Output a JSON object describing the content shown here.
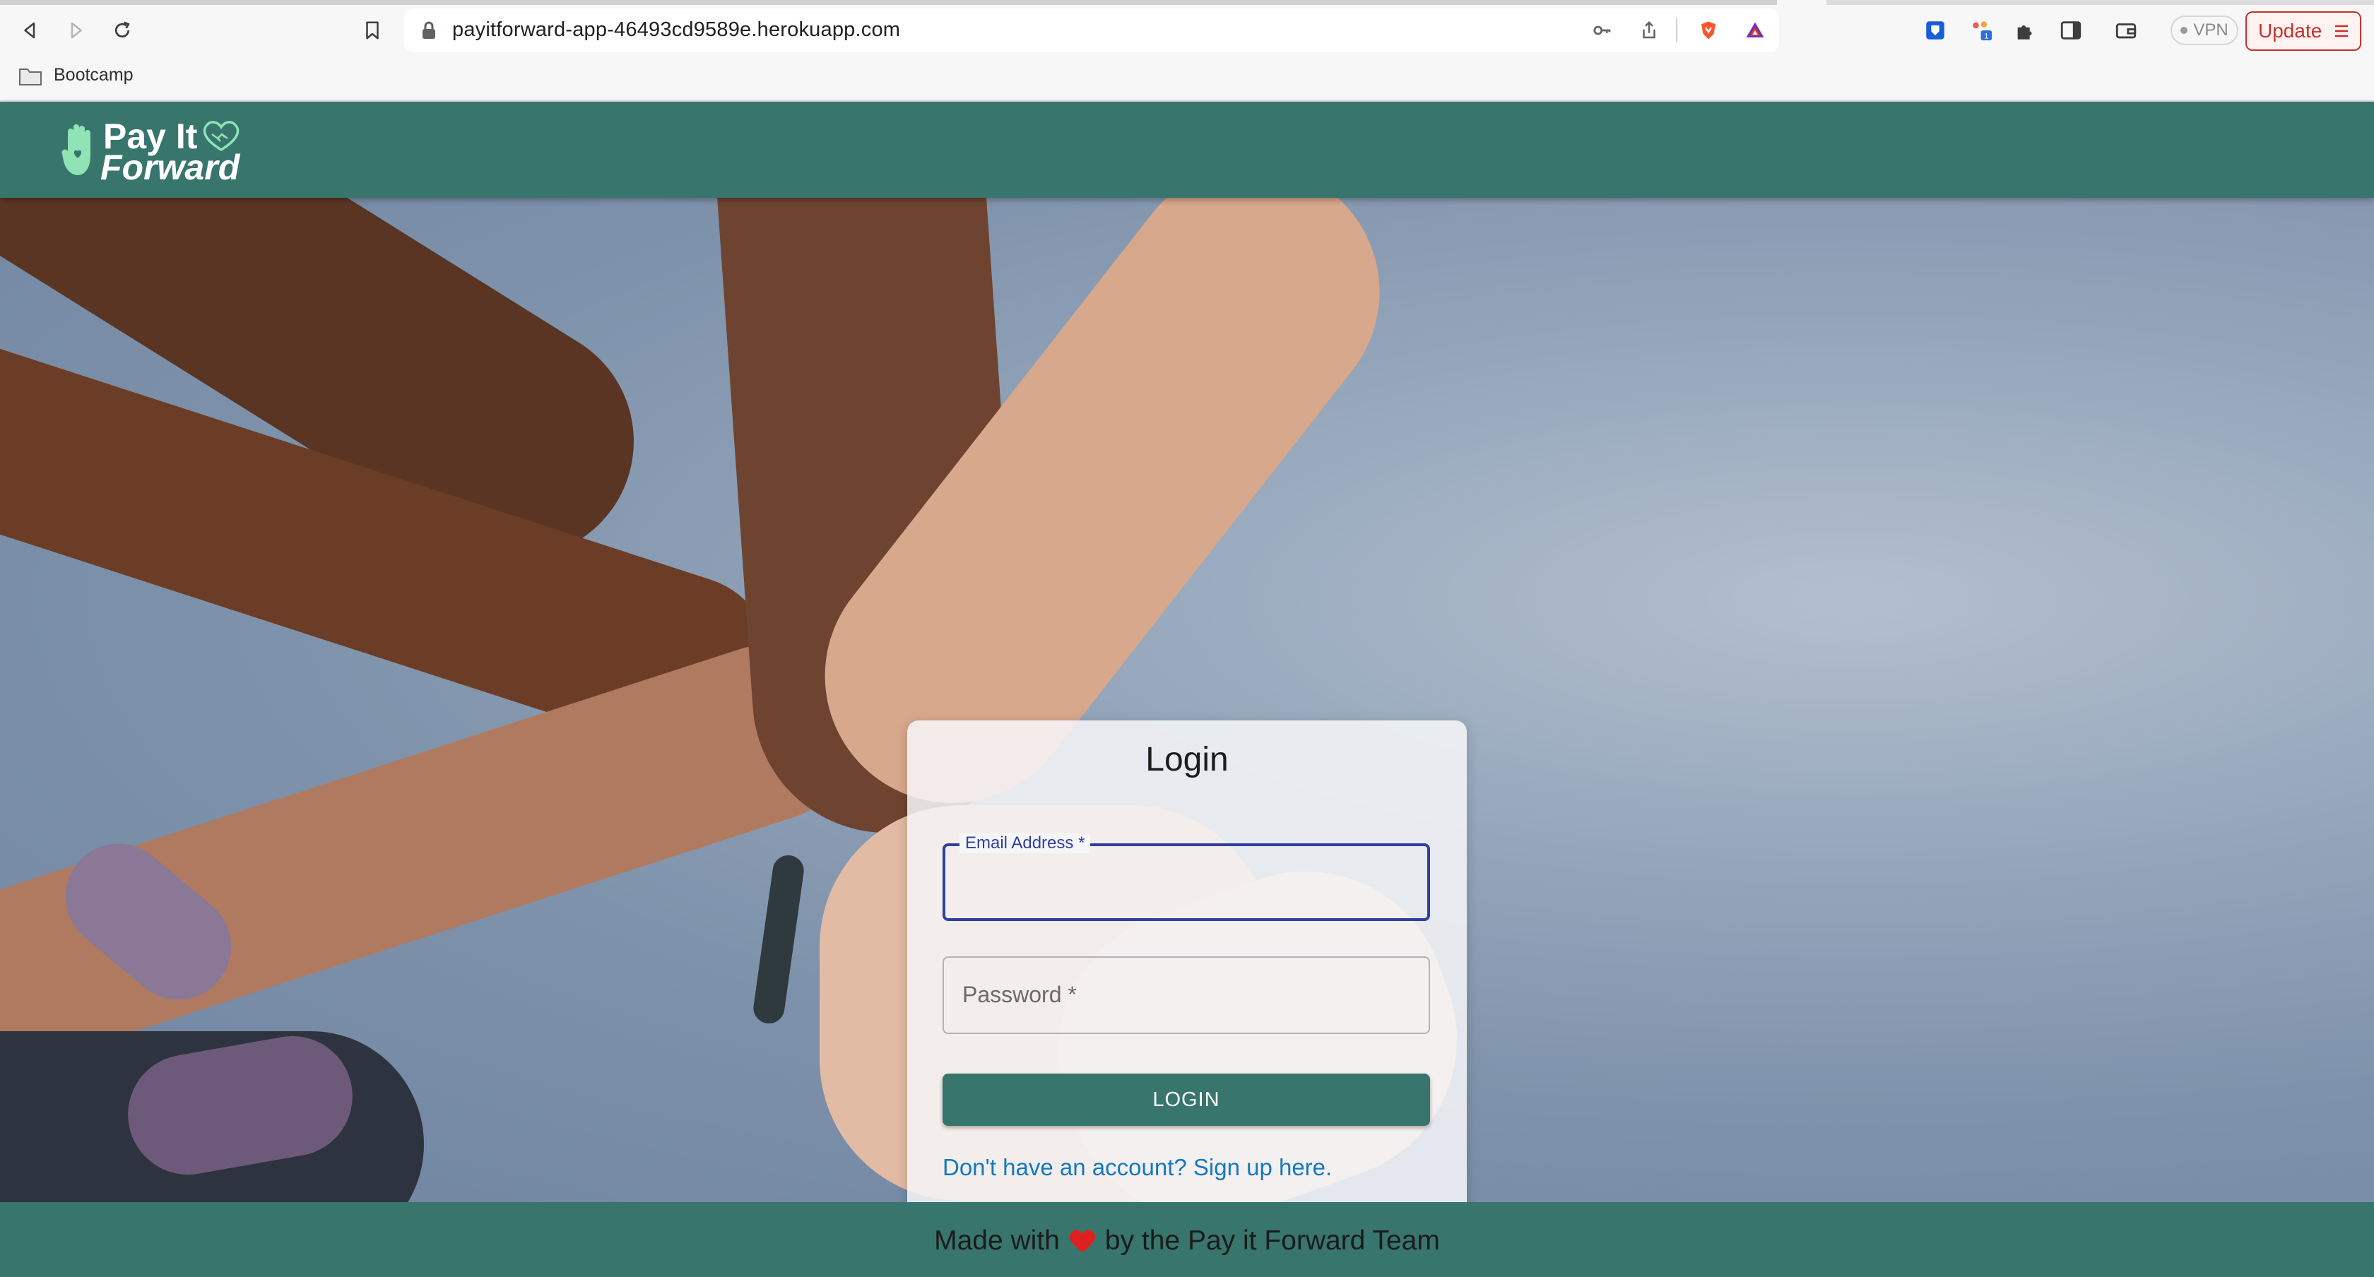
{
  "browser": {
    "url": "payitforward-app-46493cd9589e.herokuapp.com",
    "bookmarks": [
      {
        "label": "Bootcamp",
        "icon": "folder-icon"
      }
    ],
    "vpn_label": "VPN",
    "update_label": "Update",
    "extension_badge": "1",
    "update_color": "#c9302c"
  },
  "header": {
    "logo_line1": "Pay It",
    "logo_line2": "Forward",
    "brand_color": "#38756c",
    "logo_accent": "#8fe3b4"
  },
  "login": {
    "title": "Login",
    "email_label": "Email Address *",
    "email_value": "",
    "password_label": "Password *",
    "password_value": "",
    "button_label": "LOGIN",
    "signup_text": "Don't have an account? Sign up here.",
    "focus_color": "#2f3fa0",
    "link_color": "#1479c0"
  },
  "footer": {
    "text_before": "Made with",
    "text_after": "by the Pay it Forward Team",
    "heart_color": "#e02020"
  }
}
